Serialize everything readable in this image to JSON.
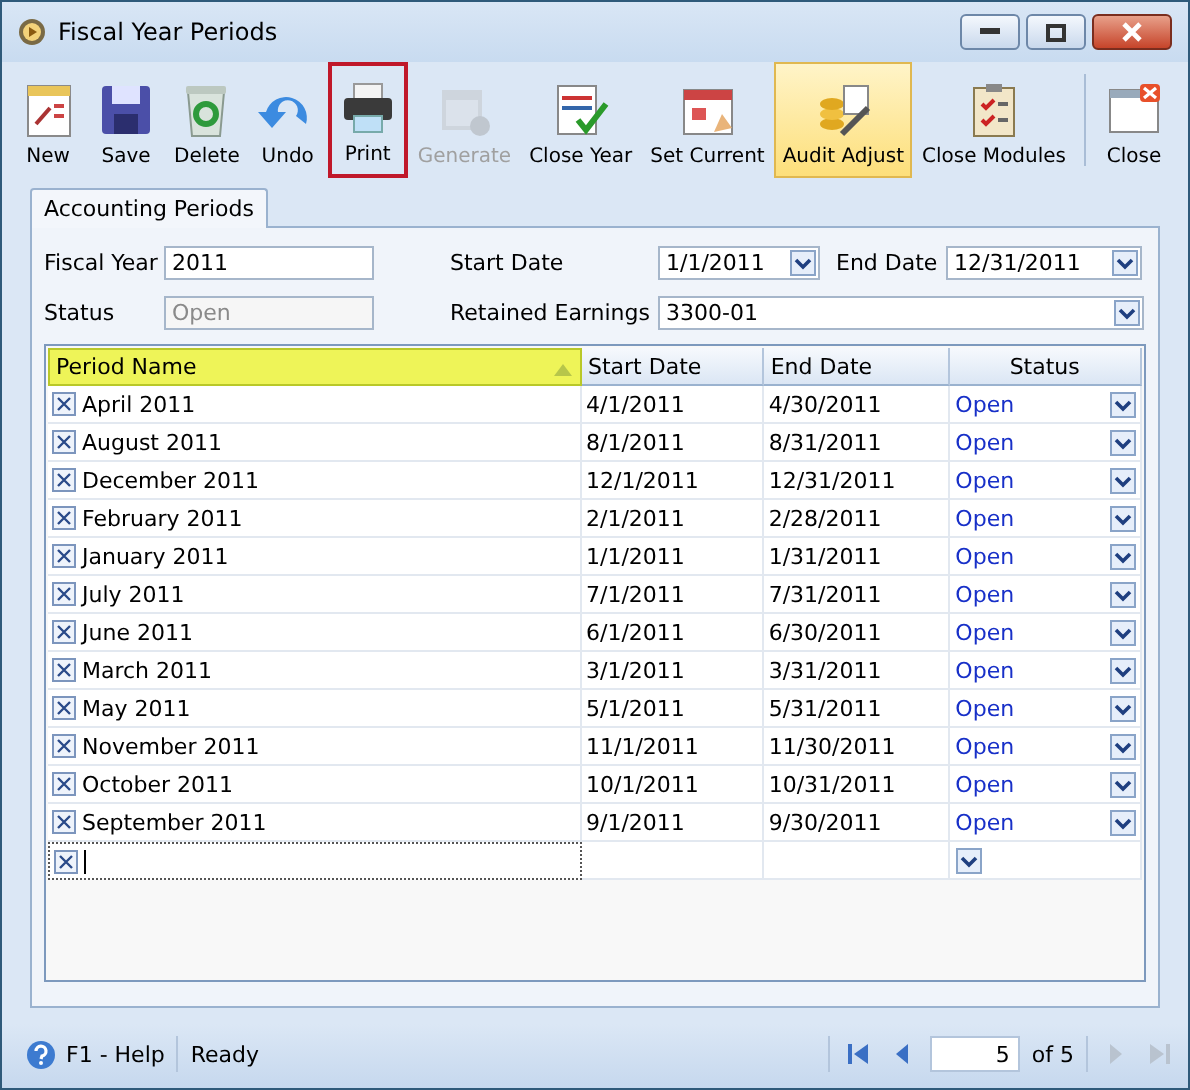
{
  "window": {
    "title": "Fiscal Year Periods"
  },
  "toolbar": [
    {
      "label": "New",
      "disabled": false,
      "active": false,
      "highlighted": false
    },
    {
      "label": "Save",
      "disabled": false,
      "active": false,
      "highlighted": false
    },
    {
      "label": "Delete",
      "disabled": false,
      "active": false,
      "highlighted": false
    },
    {
      "label": "Undo",
      "disabled": false,
      "active": false,
      "highlighted": false
    },
    {
      "label": "Print",
      "disabled": false,
      "active": false,
      "highlighted": true
    },
    {
      "label": "Generate",
      "disabled": true,
      "active": false,
      "highlighted": false
    },
    {
      "label": "Close Year",
      "disabled": false,
      "active": false,
      "highlighted": false
    },
    {
      "label": "Set Current",
      "disabled": false,
      "active": false,
      "highlighted": false
    },
    {
      "label": "Audit Adjust",
      "disabled": false,
      "active": true,
      "highlighted": false
    },
    {
      "label": "Close Modules",
      "disabled": false,
      "active": false,
      "highlighted": false
    },
    {
      "label": "Close",
      "disabled": false,
      "active": false,
      "highlighted": false
    }
  ],
  "tabs": [
    {
      "label": "Accounting Periods",
      "selected": true
    }
  ],
  "form": {
    "fiscal_year": {
      "label": "Fiscal Year",
      "value": "2011"
    },
    "status": {
      "label": "Status",
      "value": "Open",
      "disabled": true
    },
    "start_date": {
      "label": "Start Date",
      "value": "1/1/2011"
    },
    "end_date": {
      "label": "End Date",
      "value": "12/31/2011"
    },
    "retained_earnings": {
      "label": "Retained Earnings",
      "value": "3300-01"
    }
  },
  "table": {
    "columns": [
      {
        "label": "Period Name",
        "sorted": true
      },
      {
        "label": "Start Date",
        "sorted": false
      },
      {
        "label": "End Date",
        "sorted": false
      },
      {
        "label": "Status",
        "sorted": false
      }
    ],
    "rows": [
      {
        "name": "April 2011",
        "start": "4/1/2011",
        "end": "4/30/2011",
        "status": "Open"
      },
      {
        "name": "August 2011",
        "start": "8/1/2011",
        "end": "8/31/2011",
        "status": "Open"
      },
      {
        "name": "December 2011",
        "start": "12/1/2011",
        "end": "12/31/2011",
        "status": "Open"
      },
      {
        "name": "February 2011",
        "start": "2/1/2011",
        "end": "2/28/2011",
        "status": "Open"
      },
      {
        "name": "January 2011",
        "start": "1/1/2011",
        "end": "1/31/2011",
        "status": "Open"
      },
      {
        "name": "July 2011",
        "start": "7/1/2011",
        "end": "7/31/2011",
        "status": "Open"
      },
      {
        "name": "June 2011",
        "start": "6/1/2011",
        "end": "6/30/2011",
        "status": "Open"
      },
      {
        "name": "March 2011",
        "start": "3/1/2011",
        "end": "3/31/2011",
        "status": "Open"
      },
      {
        "name": "May 2011",
        "start": "5/1/2011",
        "end": "5/31/2011",
        "status": "Open"
      },
      {
        "name": "November 2011",
        "start": "11/1/2011",
        "end": "11/30/2011",
        "status": "Open"
      },
      {
        "name": "October 2011",
        "start": "10/1/2011",
        "end": "10/31/2011",
        "status": "Open"
      },
      {
        "name": "September 2011",
        "start": "9/1/2011",
        "end": "9/30/2011",
        "status": "Open"
      }
    ]
  },
  "status_bar": {
    "help": "F1 - Help",
    "message": "Ready",
    "page": "5",
    "of": "of 5"
  }
}
